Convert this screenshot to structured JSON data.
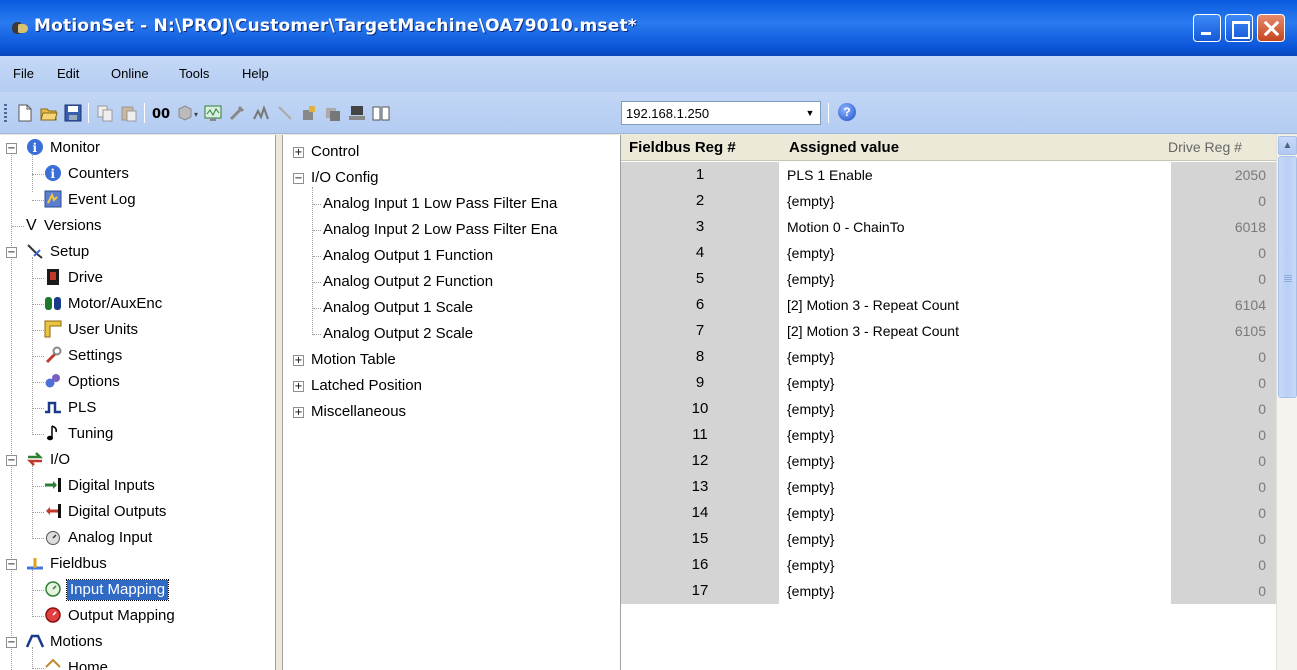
{
  "window": {
    "title": "MotionSet - N:\\PROJ\\Customer\\TargetMachine\\OA79010.mset*"
  },
  "menu": [
    "File",
    "Edit",
    "Online",
    "Tools",
    "Help"
  ],
  "toolbar": {
    "ip_address": "192.168.1.250",
    "help_glyph": "?"
  },
  "left_tree": {
    "items": [
      {
        "label": "Monitor",
        "icon": "info-icon"
      },
      {
        "label": "Counters",
        "icon": "info-icon"
      },
      {
        "label": "Event Log",
        "icon": "event-log-icon"
      },
      {
        "label": "Versions",
        "icon": "v-icon"
      },
      {
        "label": "Setup",
        "icon": "setup-icon"
      },
      {
        "label": "Drive",
        "icon": "drive-icon"
      },
      {
        "label": "Motor/AuxEnc",
        "icon": "motor-icon"
      },
      {
        "label": "User Units",
        "icon": "ruler-icon"
      },
      {
        "label": "Settings",
        "icon": "wrench-icon"
      },
      {
        "label": "Options",
        "icon": "gears-icon"
      },
      {
        "label": "PLS",
        "icon": "pulse-icon"
      },
      {
        "label": "Tuning",
        "icon": "note-icon"
      },
      {
        "label": "I/O",
        "icon": "io-arrows-icon"
      },
      {
        "label": "Digital Inputs",
        "icon": "digital-input-icon"
      },
      {
        "label": "Digital Outputs",
        "icon": "digital-output-icon"
      },
      {
        "label": "Analog Input",
        "icon": "gauge-icon"
      },
      {
        "label": "Fieldbus",
        "icon": "fieldbus-icon"
      },
      {
        "label": "Input Mapping",
        "icon": "green-gauge-icon"
      },
      {
        "label": "Output Mapping",
        "icon": "red-gauge-icon"
      },
      {
        "label": "Motions",
        "icon": "motion-curve-icon"
      },
      {
        "label": "Home",
        "icon": "home-icon"
      }
    ]
  },
  "mid_tree": {
    "items": [
      {
        "label": "Control"
      },
      {
        "label": "I/O Config"
      },
      {
        "label": "Analog Input 1 Low Pass Filter Ena"
      },
      {
        "label": "Analog Input 2 Low Pass Filter Ena"
      },
      {
        "label": "Analog Output 1 Function"
      },
      {
        "label": "Analog Output 2 Function"
      },
      {
        "label": "Analog Output 1 Scale"
      },
      {
        "label": "Analog Output 2 Scale"
      },
      {
        "label": "Motion Table"
      },
      {
        "label": "Latched Position"
      },
      {
        "label": "Miscellaneous"
      }
    ]
  },
  "grid": {
    "headers": [
      "Fieldbus Reg #",
      "Assigned value",
      "Drive Reg #"
    ],
    "rows": [
      {
        "reg": "1",
        "value": "PLS 1 Enable",
        "drive": "2050"
      },
      {
        "reg": "2",
        "value": "{empty}",
        "drive": "0"
      },
      {
        "reg": "3",
        "value": "Motion 0 - ChainTo",
        "drive": "6018"
      },
      {
        "reg": "4",
        "value": "{empty}",
        "drive": "0"
      },
      {
        "reg": "5",
        "value": "{empty}",
        "drive": "0"
      },
      {
        "reg": "6",
        "value": "[2] Motion 3 - Repeat Count",
        "drive": "6104"
      },
      {
        "reg": "7",
        "value": "[2] Motion 3 - Repeat Count",
        "drive": "6105"
      },
      {
        "reg": "8",
        "value": "{empty}",
        "drive": "0"
      },
      {
        "reg": "9",
        "value": "{empty}",
        "drive": "0"
      },
      {
        "reg": "10",
        "value": "{empty}",
        "drive": "0"
      },
      {
        "reg": "11",
        "value": "{empty}",
        "drive": "0"
      },
      {
        "reg": "12",
        "value": "{empty}",
        "drive": "0"
      },
      {
        "reg": "13",
        "value": "{empty}",
        "drive": "0"
      },
      {
        "reg": "14",
        "value": "{empty}",
        "drive": "0"
      },
      {
        "reg": "15",
        "value": "{empty}",
        "drive": "0"
      },
      {
        "reg": "16",
        "value": "{empty}",
        "drive": "0"
      },
      {
        "reg": "17",
        "value": "{empty}",
        "drive": "0"
      }
    ]
  },
  "colors": {
    "title_bar": "#0a5ae0",
    "selection": "#316ac5",
    "grid_gray": "#d4d4d4"
  }
}
